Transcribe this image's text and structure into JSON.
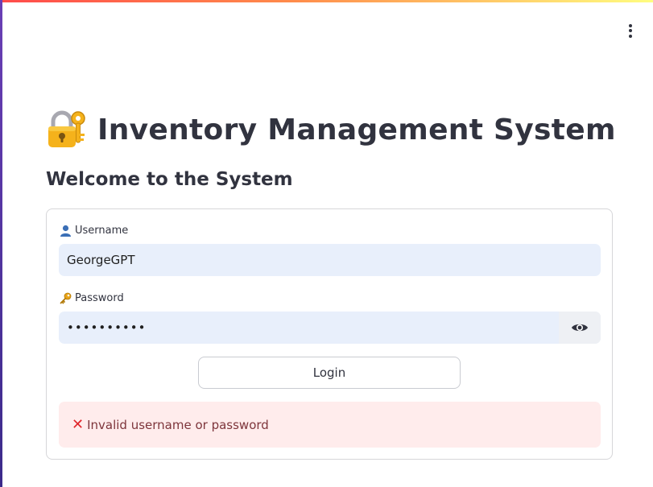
{
  "app": {
    "title": "Inventory Management System",
    "subtitle": "Welcome to the System",
    "title_icon": "locked-with-key-icon"
  },
  "form": {
    "username_label": "Username",
    "username_icon": "user-silhouette-icon",
    "username_value": "GeorgeGPT",
    "password_label": "Password",
    "password_icon": "key-icon",
    "password_value": "••••••••••",
    "login_label": "Login"
  },
  "error": {
    "icon": "cross-mark-icon",
    "message": "Invalid username or password"
  },
  "colors": {
    "accent_bar": "#ff4b4b",
    "input_bg": "#e8effb",
    "error_bg": "#ffecec",
    "error_text": "#7d353b",
    "text": "#31333f"
  }
}
